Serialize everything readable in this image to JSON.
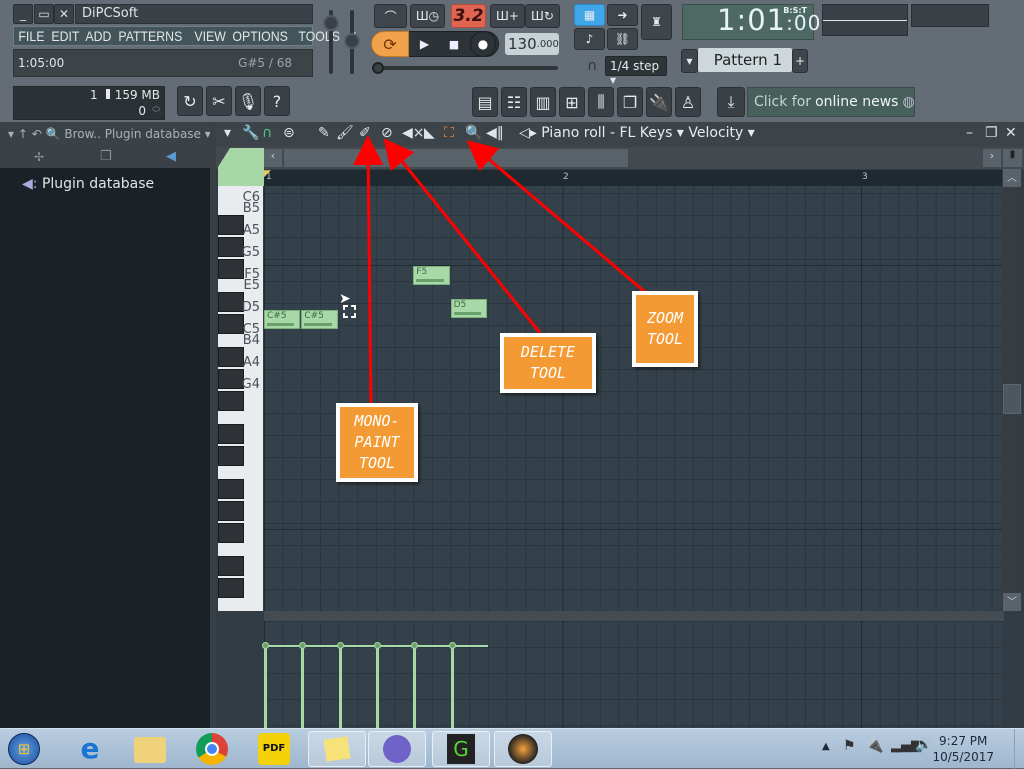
{
  "window": {
    "title": "DiPCSoft",
    "controls": [
      "minimize",
      "maximize",
      "close"
    ]
  },
  "menu": [
    "FILE",
    "EDIT",
    "ADD",
    "PATTERNS",
    "VIEW",
    "OPTIONS",
    "TOOLS",
    "?"
  ],
  "hint_bar": {
    "time": "1:05:00",
    "note": "G#5 / 68"
  },
  "transport": {
    "pat_song_label": "3.2",
    "tempo_int": "130",
    "tempo_dec": ".000",
    "snap": "1/4 step"
  },
  "time_display": {
    "main": "1:01",
    "sub": ":00",
    "mode": "B:S:T"
  },
  "pattern": {
    "name": "Pattern 1",
    "add": "+"
  },
  "memory": {
    "cpu": "1",
    "ram": "159 MB",
    "polyphony": "0"
  },
  "news": {
    "prefix": "Click for",
    "highlight": "online news"
  },
  "browser": {
    "title": "Brow.. Plugin database",
    "tree_root": "Plugin database"
  },
  "piano_roll": {
    "title": "Piano roll - FL Keys",
    "event_target": "Velocity",
    "bar_labels": [
      "1",
      "2",
      "3"
    ],
    "key_labels": [
      "C6",
      "B5",
      "A5",
      "G5",
      "F5",
      "E5",
      "D5",
      "C5",
      "B4",
      "A4",
      "G4"
    ],
    "notes": [
      {
        "label": "C#5",
        "pitch": "C#5",
        "start_step": 0,
        "length_steps": 2
      },
      {
        "label": "C#5",
        "pitch": "C#5",
        "start_step": 2,
        "length_steps": 2
      },
      {
        "label": "F5",
        "pitch": "F5",
        "start_step": 8,
        "length_steps": 2
      },
      {
        "label": "D5",
        "pitch": "D5",
        "start_step": 10,
        "length_steps": 2
      }
    ],
    "velocity_steps": [
      0,
      2,
      4,
      6,
      8,
      10
    ],
    "tools": [
      "draw",
      "paint",
      "mono-paint",
      "delete",
      "mute",
      "slice",
      "select",
      "zoom",
      "playback"
    ]
  },
  "callouts": [
    {
      "id": "mono",
      "lines": [
        "MONO-",
        "PAINT",
        "TOOL"
      ]
    },
    {
      "id": "delete",
      "lines": [
        "DELETE",
        "TOOL"
      ]
    },
    {
      "id": "zoom",
      "lines": [
        "ZOOM",
        "TOOL"
      ]
    }
  ],
  "taskbar": {
    "apps": [
      "start",
      "internet-explorer",
      "file-explorer",
      "chrome",
      "pdf-reader",
      "sticky-notes",
      "bittorrent",
      "greenshot",
      "fl-studio"
    ],
    "clock_time": "9:27 PM",
    "clock_date": "10/5/2017"
  },
  "colors": {
    "note_fill": "#a8d8a8",
    "callout": "#f49a34",
    "arrow": "#ff0000",
    "pat_song": "#e06450",
    "loop_button": "#f3a24c"
  }
}
